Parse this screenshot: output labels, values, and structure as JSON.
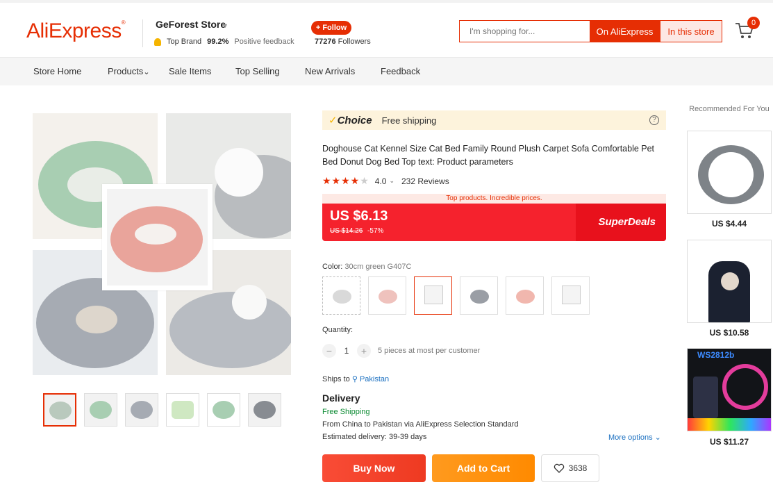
{
  "header": {
    "logo": "AliExpress",
    "store_name": "GeForest Store",
    "top_brand": "Top Brand",
    "positive_pct": "99.2%",
    "positive_label": "Positive feedback",
    "follow_label": "+ Follow",
    "followers_count": "77276",
    "followers_label": "Followers",
    "search_placeholder": "I'm shopping for...",
    "search_btn_ae": "On AliExpress",
    "search_btn_store": "In this store",
    "cart_count": "0"
  },
  "nav": {
    "items": [
      "Store Home",
      "Products",
      "Sale Items",
      "Top Selling",
      "New Arrivals",
      "Feedback"
    ]
  },
  "product": {
    "choice_label": "Choice",
    "free_shipping": "Free shipping",
    "help": "?",
    "title": "Doghouse Cat Kennel Size Cat Bed Family Round Plush Carpet Sofa Comfortable Pet Bed Donut Dog Bed Top text: Product parameters",
    "stars": "★★★★",
    "star_empty": "★",
    "rating_value": 4.0,
    "rating": "4.0",
    "reviews": "232 Reviews",
    "deal_strip": "Top products. Incredible prices.",
    "price": "US $6.13",
    "old_price": "US $14.26",
    "discount": "-57%",
    "superdeals": "SuperDeals",
    "color_label": "Color:",
    "color_value": "30cm green G407C",
    "quantity_label": "Quantity:",
    "quantity_minus": "−",
    "quantity_plus": "+",
    "quantity": "1",
    "quantity_note": "5 pieces at most per customer",
    "ships_to_label": "Ships to",
    "ships_to": "Pakistan",
    "delivery_heading": "Delivery",
    "free_shipping_green": "Free Shipping",
    "from_line": "From China to Pakistan via AliExpress Selection Standard",
    "estimated": "Estimated delivery: 39-39 days",
    "more_options": "More options",
    "buy_now": "Buy Now",
    "add_to_cart": "Add to Cart",
    "wishlist_count": "3638"
  },
  "swatches": [
    {
      "label": "light grey",
      "color": "#d9d9d9"
    },
    {
      "label": "pink",
      "color": "#efc2bd"
    },
    {
      "label": "No Photo",
      "color": "#f4f4f4"
    },
    {
      "label": "dark grey",
      "color": "#9a9ea5"
    },
    {
      "label": "pink 2",
      "color": "#f1b7ae"
    },
    {
      "label": "No Photo",
      "color": "#f4f4f4"
    }
  ],
  "recommended": {
    "title": "Recommended For You",
    "items": [
      {
        "price": "US $4.44"
      },
      {
        "price": "US $10.58"
      },
      {
        "price": "US $11.27",
        "overlay": "WS2812b"
      }
    ]
  },
  "colors": {
    "brand": "#e62e04",
    "price_bg": "#f5222d",
    "buy_now": "#f94c36",
    "add_to_cart": "#ff8a00",
    "choice_bg": "#fdf3dc",
    "link": "#1a6fc0",
    "free_ship_green": "#0b8a32"
  }
}
